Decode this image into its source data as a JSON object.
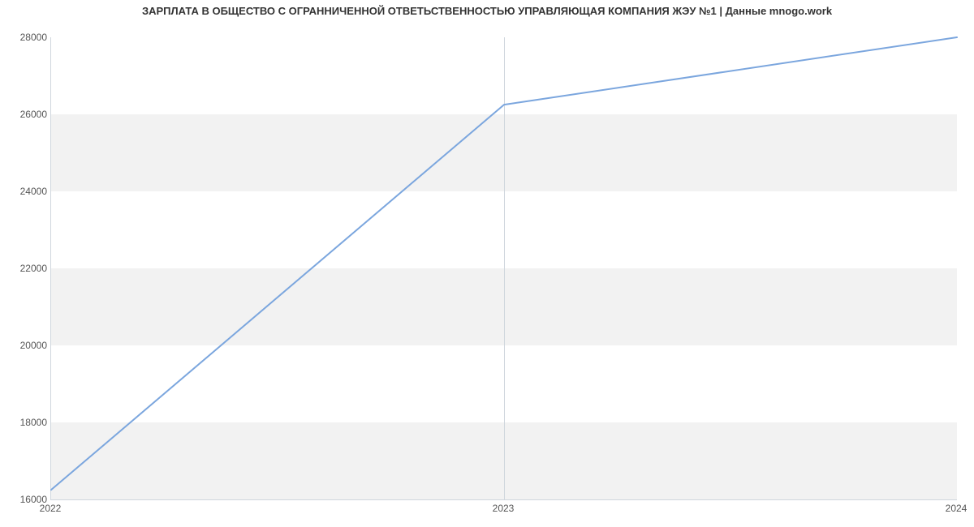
{
  "chart_data": {
    "type": "line",
    "title": "ЗАРПЛАТА В ОБЩЕСТВО С ОГРАННИЧЕННОЙ ОТВЕТЬСТВЕННОСТЬЮ УПРАВЛЯЮЩАЯ КОМПАНИЯ ЖЭУ №1 | Данные mnogo.work",
    "x": [
      2022,
      2023,
      2024
    ],
    "values": [
      16250,
      26250,
      28000
    ],
    "xlabel": "",
    "ylabel": "",
    "xlim": [
      2022,
      2024
    ],
    "ylim": [
      16000,
      28000
    ],
    "x_ticks": [
      2022,
      2023,
      2024
    ],
    "y_ticks": [
      16000,
      18000,
      20000,
      22000,
      24000,
      26000,
      28000
    ],
    "line_color": "#7ba6de",
    "grid_band_color": "#f2f2f2"
  }
}
